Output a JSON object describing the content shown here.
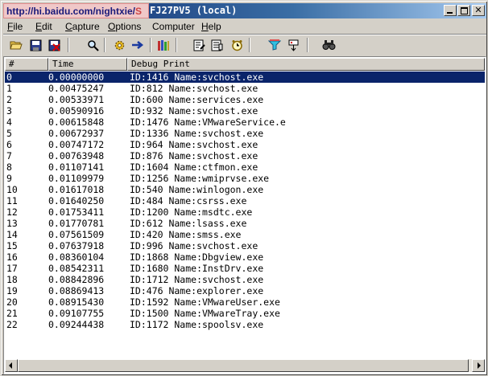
{
  "window": {
    "url_overlay": "http://hi.baidu.com/nightxie/",
    "url_overlay_tail": "S",
    "title": "FJ27PV5 (local)"
  },
  "menu": {
    "file": {
      "first": "F",
      "rest": "ile"
    },
    "edit": {
      "first": "E",
      "rest": "dit"
    },
    "capture": {
      "first": "C",
      "rest": "apture"
    },
    "options": {
      "first": "O",
      "rest": "ptions"
    },
    "computer": {
      "first": "Co",
      "rest": "mputer",
      "ul": "m"
    },
    "help": {
      "first": "H",
      "rest": "elp"
    }
  },
  "toolbar": {
    "icons": [
      "open-folder-icon",
      "save-icon",
      "clear-icon",
      "find-icon",
      "capture-gear-icon",
      "autoscroll-arrow-icon",
      "capture-kernel-icon",
      "properties-icon",
      "highlight-icon",
      "time-icon",
      "filter-icon",
      "filter-options-icon",
      "binoculars-icon"
    ]
  },
  "columns": {
    "num": "#",
    "time": "Time",
    "debug": "Debug Print"
  },
  "rows": [
    {
      "num": "0",
      "time": "0.00000000",
      "debug": "ID:1416  Name:svchost.exe"
    },
    {
      "num": "1",
      "time": "0.00475247",
      "debug": "ID:812  Name:svchost.exe"
    },
    {
      "num": "2",
      "time": "0.00533971",
      "debug": "ID:600  Name:services.exe"
    },
    {
      "num": "3",
      "time": "0.00590916",
      "debug": "ID:932  Name:svchost.exe"
    },
    {
      "num": "4",
      "time": "0.00615848",
      "debug": "ID:1476  Name:VMwareService.e"
    },
    {
      "num": "5",
      "time": "0.00672937",
      "debug": "ID:1336  Name:svchost.exe"
    },
    {
      "num": "6",
      "time": "0.00747172",
      "debug": "ID:964  Name:svchost.exe"
    },
    {
      "num": "7",
      "time": "0.00763948",
      "debug": "ID:876  Name:svchost.exe"
    },
    {
      "num": "8",
      "time": "0.01107141",
      "debug": "ID:1604  Name:ctfmon.exe"
    },
    {
      "num": "9",
      "time": "0.01109979",
      "debug": "ID:1256  Name:wmiprvse.exe"
    },
    {
      "num": "10",
      "time": "0.01617018",
      "debug": "ID:540  Name:winlogon.exe"
    },
    {
      "num": "11",
      "time": "0.01640250",
      "debug": "ID:484  Name:csrss.exe"
    },
    {
      "num": "12",
      "time": "0.01753411",
      "debug": "ID:1200  Name:msdtc.exe"
    },
    {
      "num": "13",
      "time": "0.01770781",
      "debug": "ID:612  Name:lsass.exe"
    },
    {
      "num": "14",
      "time": "0.07561509",
      "debug": "ID:420  Name:smss.exe"
    },
    {
      "num": "15",
      "time": "0.07637918",
      "debug": "ID:996  Name:svchost.exe"
    },
    {
      "num": "16",
      "time": "0.08360104",
      "debug": "ID:1868  Name:Dbgview.exe"
    },
    {
      "num": "17",
      "time": "0.08542311",
      "debug": "ID:1680  Name:InstDrv.exe"
    },
    {
      "num": "18",
      "time": "0.08842896",
      "debug": "ID:1712  Name:svchost.exe"
    },
    {
      "num": "19",
      "time": "0.08869413",
      "debug": "ID:476  Name:explorer.exe"
    },
    {
      "num": "20",
      "time": "0.08915430",
      "debug": "ID:1592  Name:VMwareUser.exe"
    },
    {
      "num": "21",
      "time": "0.09107755",
      "debug": "ID:1500  Name:VMwareTray.exe"
    },
    {
      "num": "22",
      "time": "0.09244438",
      "debug": "ID:1172  Name:spoolsv.exe"
    }
  ],
  "selected_row": 0,
  "colors": {
    "title_start": "#0a246a",
    "title_end": "#a6caf0",
    "selection": "#0a246a",
    "chrome": "#d4d0c8"
  }
}
